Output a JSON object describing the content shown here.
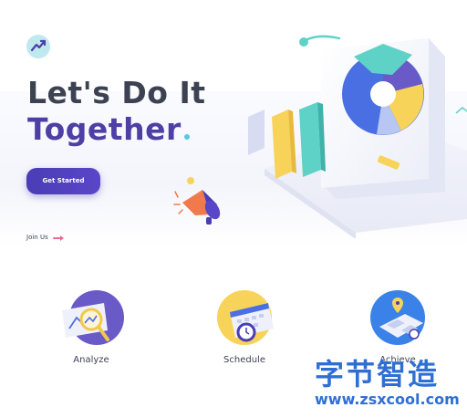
{
  "hero": {
    "title_line1": "Let's Do It",
    "title_line2": "Together",
    "cta_label": "Get Started",
    "join_label": "Join Us"
  },
  "features": [
    {
      "label": "Analyze",
      "icon": "magnifier-chart-icon"
    },
    {
      "label": "Schedule",
      "icon": "calendar-clock-icon"
    },
    {
      "label": "Achieve",
      "icon": "map-pin-icon"
    }
  ],
  "watermark": {
    "text_cn": "字节智造",
    "url": "www.zsxcool.com"
  },
  "colors": {
    "primary": "#4d3fa6",
    "heading": "#3d4252",
    "accent_cyan": "#5dc3e6",
    "accent_yellow": "#f8d35a",
    "accent_blue": "#4a6fe3",
    "watermark": "#2f6fd4"
  }
}
